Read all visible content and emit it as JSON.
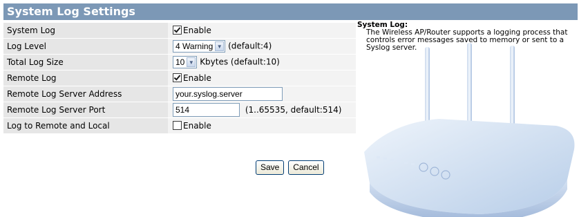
{
  "header": {
    "title": "System Log Settings"
  },
  "rows": {
    "system_log": {
      "label": "System Log",
      "checkbox_label": "Enable",
      "checked": true
    },
    "log_level": {
      "label": "Log Level",
      "selected": "4 Warning",
      "hint": "(default:4)"
    },
    "total_log_size": {
      "label": "Total Log Size",
      "selected": "10",
      "hint": "Kbytes (default:10)"
    },
    "remote_log": {
      "label": "Remote Log",
      "checkbox_label": "Enable",
      "checked": true
    },
    "remote_server_address": {
      "label": "Remote Log Server Address",
      "value": "your.syslog.server"
    },
    "remote_server_port": {
      "label": "Remote Log Server Port",
      "value": "514",
      "hint": "(1..65535, default:514)"
    },
    "log_remote_and_local": {
      "label": "Log to Remote and Local",
      "checkbox_label": "Enable",
      "checked": false
    }
  },
  "actions": {
    "save": "Save",
    "cancel": "Cancel"
  },
  "help": {
    "title": "System Log:",
    "body": "The Wireless AP/Router supports a logging process that controls error messages saved to memory or sent to a Syslog server."
  },
  "icons": {
    "select_arrow": "chevron-down-icon",
    "router_image": "wireless-router-illustration"
  },
  "colors": {
    "title_bar": "#7c98b6",
    "label_bg": "#e6e6e6",
    "value_bg": "#f3f3f3"
  }
}
